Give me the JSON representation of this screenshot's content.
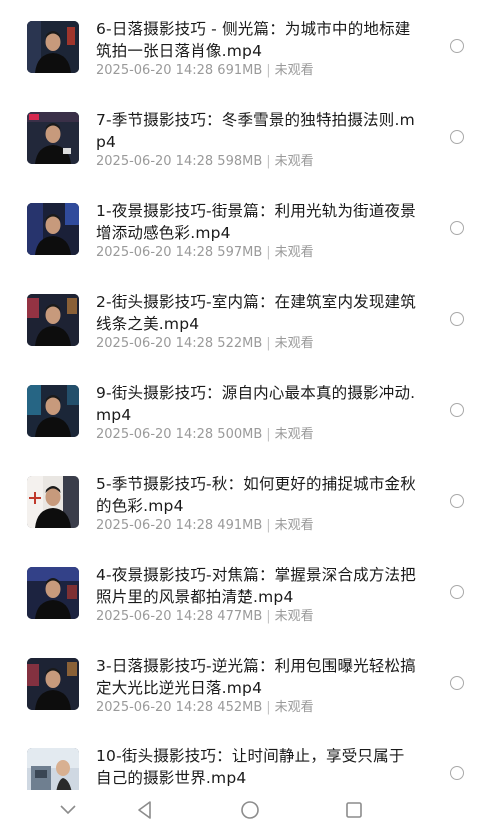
{
  "files": [
    {
      "title": "6-日落摄影技巧 - 侧光篇：为城市中的地标建筑拍一张日落肖像.mp4",
      "date": "2025-06-20 14:28",
      "size": "691MB",
      "status": "未观看",
      "thumb_bg": "#1c2536",
      "thumb_accent": "#c0392b"
    },
    {
      "title": "7-季节摄影技巧：冬季雪景的独特拍摄法则.mp4",
      "date": "2025-06-20 14:28",
      "size": "598MB",
      "status": "未观看",
      "thumb_bg": "#22283a",
      "thumb_accent": "#d6284f"
    },
    {
      "title": "1-夜景摄影技巧-街景篇：利用光轨为街道夜景增添动感色彩.mp4",
      "date": "2025-06-20 14:28",
      "size": "597MB",
      "status": "未观看",
      "thumb_bg": "#1a2038",
      "thumb_accent": "#3a5ec8"
    },
    {
      "title": "2-街头摄影技巧-室内篇：在建筑室内发现建筑线条之美.mp4",
      "date": "2025-06-20 14:28",
      "size": "522MB",
      "status": "未观看",
      "thumb_bg": "#1d2233",
      "thumb_accent": "#c83a4a"
    },
    {
      "title": "9-街头摄影技巧：源自内心最本真的摄影冲动.mp4",
      "date": "2025-06-20 14:28",
      "size": "500MB",
      "status": "未观看",
      "thumb_bg": "#1b2638",
      "thumb_accent": "#2f8fb8"
    },
    {
      "title": "5-季节摄影技巧-秋：如何更好的捕捉城市金秋的色彩.mp4",
      "date": "2025-06-20 14:28",
      "size": "491MB",
      "status": "未观看",
      "thumb_bg": "#e9e6e2",
      "thumb_accent": "#c0392b"
    },
    {
      "title": "4-夜景摄影技巧-对焦篇：掌握景深合成方法把照片里的风景都拍清楚.mp4",
      "date": "2025-06-20 14:28",
      "size": "477MB",
      "status": "未观看",
      "thumb_bg": "#1c2340",
      "thumb_accent": "#4a5fd0"
    },
    {
      "title": "3-日落摄影技巧-逆光篇：利用包围曝光轻松搞定大光比逆光日落.mp4",
      "date": "2025-06-20 14:28",
      "size": "452MB",
      "status": "未观看",
      "thumb_bg": "#1d2334",
      "thumb_accent": "#c83a4a"
    },
    {
      "title": "10-街头摄影技巧：让时间静止，享受只属于自己的摄影世界.mp4",
      "date": "2025-06-20 14:28",
      "size": "",
      "status": "",
      "thumb_bg": "#cfd8e2",
      "thumb_accent": "#6f7f90"
    }
  ],
  "nav": {
    "back_icon": "back-triangle-icon",
    "home_icon": "home-circle-icon",
    "recents_icon": "recents-square-icon",
    "collapse_icon": "chevron-down-icon"
  }
}
